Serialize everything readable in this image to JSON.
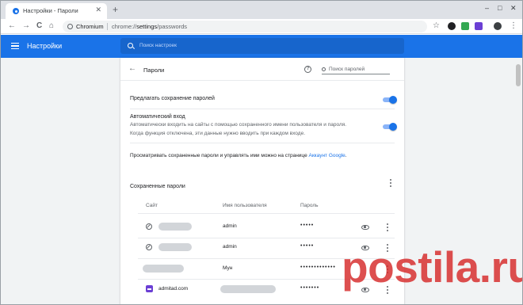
{
  "browser": {
    "tab_title": "Настройки - Пароли",
    "new_tab": "+",
    "close_tab": "✕",
    "window_buttons": {
      "minimize": "–",
      "maximize": "□",
      "close": "✕"
    },
    "nav": {
      "back": "←",
      "forward": "→",
      "reload": "C",
      "home": "⌂"
    },
    "omnibox": {
      "site_chip": "Chromium",
      "url_scheme": "chrome://",
      "url_host": "settings",
      "url_path": "/passwords"
    },
    "bookmark_star": "☆",
    "menu": "⋮"
  },
  "header": {
    "title": "Настройки",
    "search_placeholder": "Поиск настроек"
  },
  "passwords_page": {
    "back": "←",
    "title": "Пароли",
    "help": "?",
    "search_placeholder": "Поиск паролей",
    "offer_to_save": "Предлагать сохранение паролей",
    "offer_to_save_enabled": true,
    "auto_signin_title": "Автоматический вход",
    "auto_signin_desc_1": "Автоматически входить на сайты с помощью сохраненного имени пользователя и пароля.",
    "auto_signin_desc_2": "Когда функция отключена, эти данные нужно вводить при каждом входе.",
    "auto_signin_enabled": true,
    "manage_text": "Просматривать сохраненные пароли и управлять ими можно на странице ",
    "manage_link": "Аккаунт Google",
    "manage_end": ".",
    "saved_title": "Сохраненные пароли",
    "columns": {
      "site": "Сайт",
      "username": "Имя пользователя",
      "password": "Пароль"
    },
    "rows": [
      {
        "site": "",
        "username": "admin",
        "password": "•••••",
        "favicon": "globe-icon"
      },
      {
        "site": "",
        "username": "admin",
        "password": "•••••",
        "favicon": "globe-icon"
      },
      {
        "site": "",
        "username": "Мун",
        "password": "•••••••••••••",
        "favicon": ""
      },
      {
        "site": "admitad.com",
        "username": "",
        "password": "•••••••",
        "favicon": "admitad-icon"
      }
    ]
  },
  "watermark": {
    "text": "postila.ru",
    "color": "#d62828"
  }
}
